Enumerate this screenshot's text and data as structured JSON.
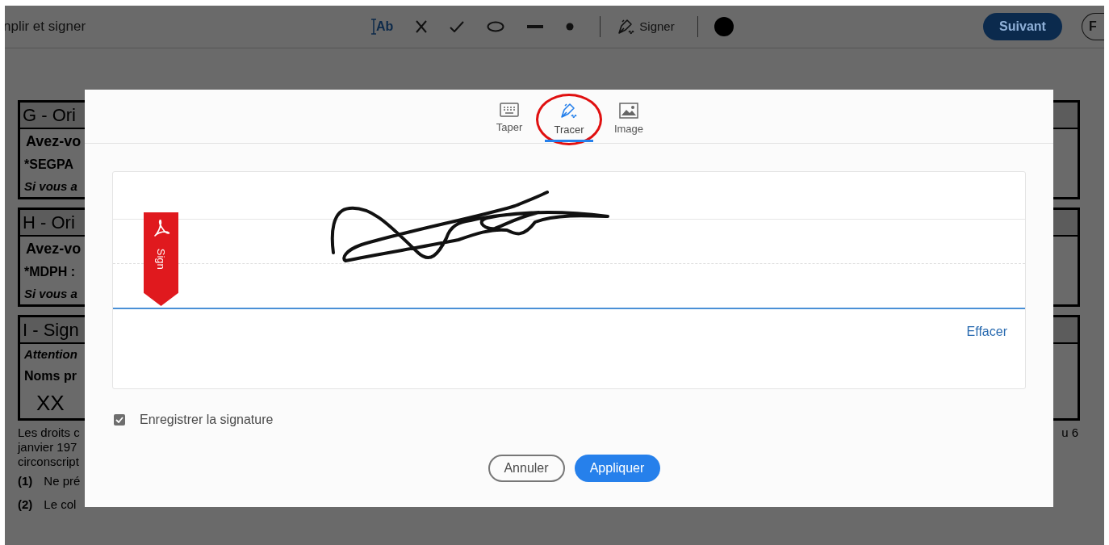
{
  "toolbar": {
    "title": "nplir et signer",
    "tools": [
      {
        "kind": "text-field",
        "label": "Ab"
      },
      {
        "kind": "cross"
      },
      {
        "kind": "check"
      },
      {
        "kind": "ellipse"
      },
      {
        "kind": "line"
      },
      {
        "kind": "dot"
      }
    ],
    "sign_label": "Signer",
    "next_button": "Suivant",
    "cut_button": "F"
  },
  "document": {
    "sections": [
      {
        "rows": [
          {
            "kind": "header",
            "text": "G - Ori"
          },
          {
            "kind": "bold",
            "text": "Avez-vo"
          },
          {
            "kind": "note",
            "text": "*SEGPA"
          },
          {
            "kind": "italic",
            "text": "Si vous a"
          }
        ]
      },
      {
        "rows": [
          {
            "kind": "header",
            "text": "H - Ori"
          },
          {
            "kind": "bold",
            "text": "Avez-vo"
          },
          {
            "kind": "note",
            "text": "*MDPH :"
          },
          {
            "kind": "italic",
            "text": "Si vous a"
          }
        ]
      },
      {
        "rows": [
          {
            "kind": "header",
            "text": "I - Sign"
          },
          {
            "kind": "italic",
            "text": "Attention"
          },
          {
            "kind": "note",
            "text": "Noms pr"
          },
          {
            "kind": "large",
            "text": "XX"
          }
        ]
      }
    ],
    "paragraph": [
      "Les droits c",
      "janvier 197",
      "circonscript"
    ],
    "paragraph_end": "u 6",
    "footnotes": [
      {
        "number": "(1)",
        "text": "Ne pré"
      },
      {
        "number": "(2)",
        "text": "Le col"
      }
    ]
  },
  "dialog": {
    "tabs": [
      {
        "kind": "keyboard",
        "label": "Taper",
        "selected": false
      },
      {
        "kind": "pen",
        "label": "Tracer",
        "selected": true
      },
      {
        "kind": "image",
        "label": "Image",
        "selected": false
      }
    ],
    "sign_tag": "Sign",
    "clear_link": "Effacer",
    "save_checkbox": {
      "label": "Enregistrer la signature",
      "checked": true
    },
    "cancel_button": "Annuler",
    "apply_button": "Appliquer"
  }
}
